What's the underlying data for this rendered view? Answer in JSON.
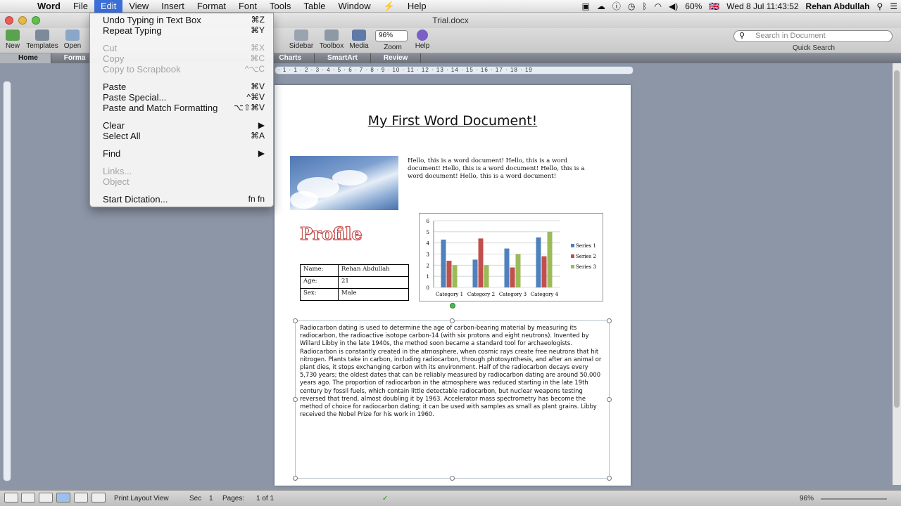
{
  "menubar": {
    "apple": "",
    "items": [
      "Word",
      "File",
      "Edit",
      "View",
      "Insert",
      "Format",
      "Font",
      "Tools",
      "Table",
      "Window",
      "⚡",
      "Help"
    ],
    "active": "Edit",
    "status": {
      "battery": "60%",
      "flag": "🇬🇧",
      "datetime": "Wed 8 Jul  11:43:52",
      "user": "Rehan Abdullah"
    }
  },
  "window": {
    "title": "Trial.docx"
  },
  "toolbar": {
    "buttons": {
      "new": "New",
      "templates": "Templates",
      "open": "Open",
      "sidebar": "Sidebar",
      "toolbox": "Toolbox",
      "media": "Media",
      "zoom": "Zoom",
      "help": "Help"
    },
    "zoom_value": "96%",
    "search_placeholder": "Search in Document",
    "quick_search": "Quick Search"
  },
  "ribbon": {
    "tabs": [
      "Home",
      "Forma",
      "Charts",
      "SmartArt",
      "Review"
    ]
  },
  "ruler": {
    "marks": "· 1 · 1 · 2 · 3 · 4 · 5 · 6 · 7 · 8 · 9 · 10 · 11 · 12 · 13 · 14 · 15 · 16 · 17 · 18 · 19"
  },
  "edit_menu": {
    "items": [
      {
        "label": "Undo Typing in Text Box",
        "shortcut": "⌘Z",
        "disabled": false
      },
      {
        "label": "Repeat Typing",
        "shortcut": "⌘Y",
        "disabled": false
      },
      {
        "sep": true
      },
      {
        "label": "Cut",
        "shortcut": "⌘X",
        "disabled": true
      },
      {
        "label": "Copy",
        "shortcut": "⌘C",
        "disabled": true
      },
      {
        "label": "Copy to Scrapbook",
        "shortcut": "^⌥C",
        "disabled": true
      },
      {
        "sep": true
      },
      {
        "label": "Paste",
        "shortcut": "⌘V",
        "disabled": false
      },
      {
        "label": "Paste Special...",
        "shortcut": "^⌘V",
        "disabled": false
      },
      {
        "label": "Paste and Match Formatting",
        "shortcut": "⌥⇧⌘V",
        "disabled": false
      },
      {
        "sep": true
      },
      {
        "label": "Clear",
        "shortcut": "▶",
        "disabled": false
      },
      {
        "label": "Select All",
        "shortcut": "⌘A",
        "disabled": false
      },
      {
        "sep": true
      },
      {
        "label": "Find",
        "shortcut": "▶",
        "disabled": false
      },
      {
        "sep": true
      },
      {
        "label": "Links...",
        "shortcut": "",
        "disabled": true
      },
      {
        "label": "Object",
        "shortcut": "",
        "disabled": true
      },
      {
        "sep": true
      },
      {
        "label": "Start Dictation...",
        "shortcut": "fn fn",
        "disabled": false
      }
    ]
  },
  "document": {
    "heading": "My First Word Document!",
    "intro": "Hello, this is a word document! Hello, this is a word document! Hello, this is a word document! Hello, this is a word document! Hello, this is a word document!",
    "profile_heading": "Profile",
    "profile": [
      {
        "key": "Name:",
        "value": "Rehan Abdullah"
      },
      {
        "key": "Age:",
        "value": "21"
      },
      {
        "key": "Sex:",
        "value": "Male"
      }
    ],
    "body": "Radiocarbon dating is used to determine the age of carbon-bearing material by measuring its radiocarbon, the radioactive isotope carbon-14 (with six protons and eight neutrons). Invented by Willard Libby in the late 1940s, the method soon became a standard tool for archaeologists. Radiocarbon is constantly created in the atmosphere, when cosmic rays create free neutrons that hit nitrogen. Plants take in carbon, including radiocarbon, through photosynthesis, and after an animal or plant dies, it stops exchanging carbon with its environment. Half of the radiocarbon decays every 5,730 years; the oldest dates that can be reliably measured by radiocarbon dating are around 50,000 years ago. The proportion of radiocarbon in the atmosphere was reduced starting in the late 19th century by fossil fuels, which contain little detectable radiocarbon, but nuclear weapons testing reversed that trend, almost doubling it by 1963. Accelerator mass spectrometry has become the method of choice for radiocarbon dating; it can be used with samples as small as plant grains. Libby received the Nobel Prize for his work in 1960."
  },
  "chart_data": {
    "type": "bar",
    "categories": [
      "Category 1",
      "Category 2",
      "Category 3",
      "Category 4"
    ],
    "series": [
      {
        "name": "Series 1",
        "values": [
          4.3,
          2.5,
          3.5,
          4.5
        ],
        "color": "#4f81bd"
      },
      {
        "name": "Series 2",
        "values": [
          2.4,
          4.4,
          1.8,
          2.8
        ],
        "color": "#c0504d"
      },
      {
        "name": "Series 3",
        "values": [
          2.0,
          2.0,
          3.0,
          5.0
        ],
        "color": "#9bbb59"
      }
    ],
    "ylim": [
      0,
      6
    ],
    "yticks": [
      "0",
      "1",
      "2",
      "3",
      "4",
      "5",
      "6"
    ],
    "legend": "right",
    "grid": true
  },
  "statusbar": {
    "view": "Print Layout View",
    "sec_label": "Sec",
    "sec": "1",
    "pages_label": "Pages:",
    "pages": "1 of 1",
    "zoom": "96%"
  }
}
